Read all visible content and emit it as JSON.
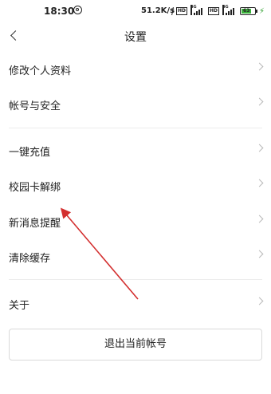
{
  "status_bar": {
    "time": "18:30",
    "speed": "51.2K/s",
    "hd1": "HD",
    "net1": "4G",
    "hd2": "HD",
    "net2": "4G",
    "battery_level": "63",
    "accent_color": "#3db33d"
  },
  "nav": {
    "title": "设置",
    "back_icon": "chevron-left-icon"
  },
  "menu": {
    "items": [
      {
        "label": "修改个人资料"
      },
      {
        "label": "帐号与安全"
      },
      {
        "label": "一键充值"
      },
      {
        "label": "校园卡解绑"
      },
      {
        "label": "新消息提醒"
      },
      {
        "label": "清除缓存"
      },
      {
        "label": "关于"
      }
    ],
    "chevron_icon": "chevron-right-icon"
  },
  "logout": {
    "label": "退出当前帐号"
  },
  "annotation": {
    "arrow_color": "#d32f2f"
  }
}
